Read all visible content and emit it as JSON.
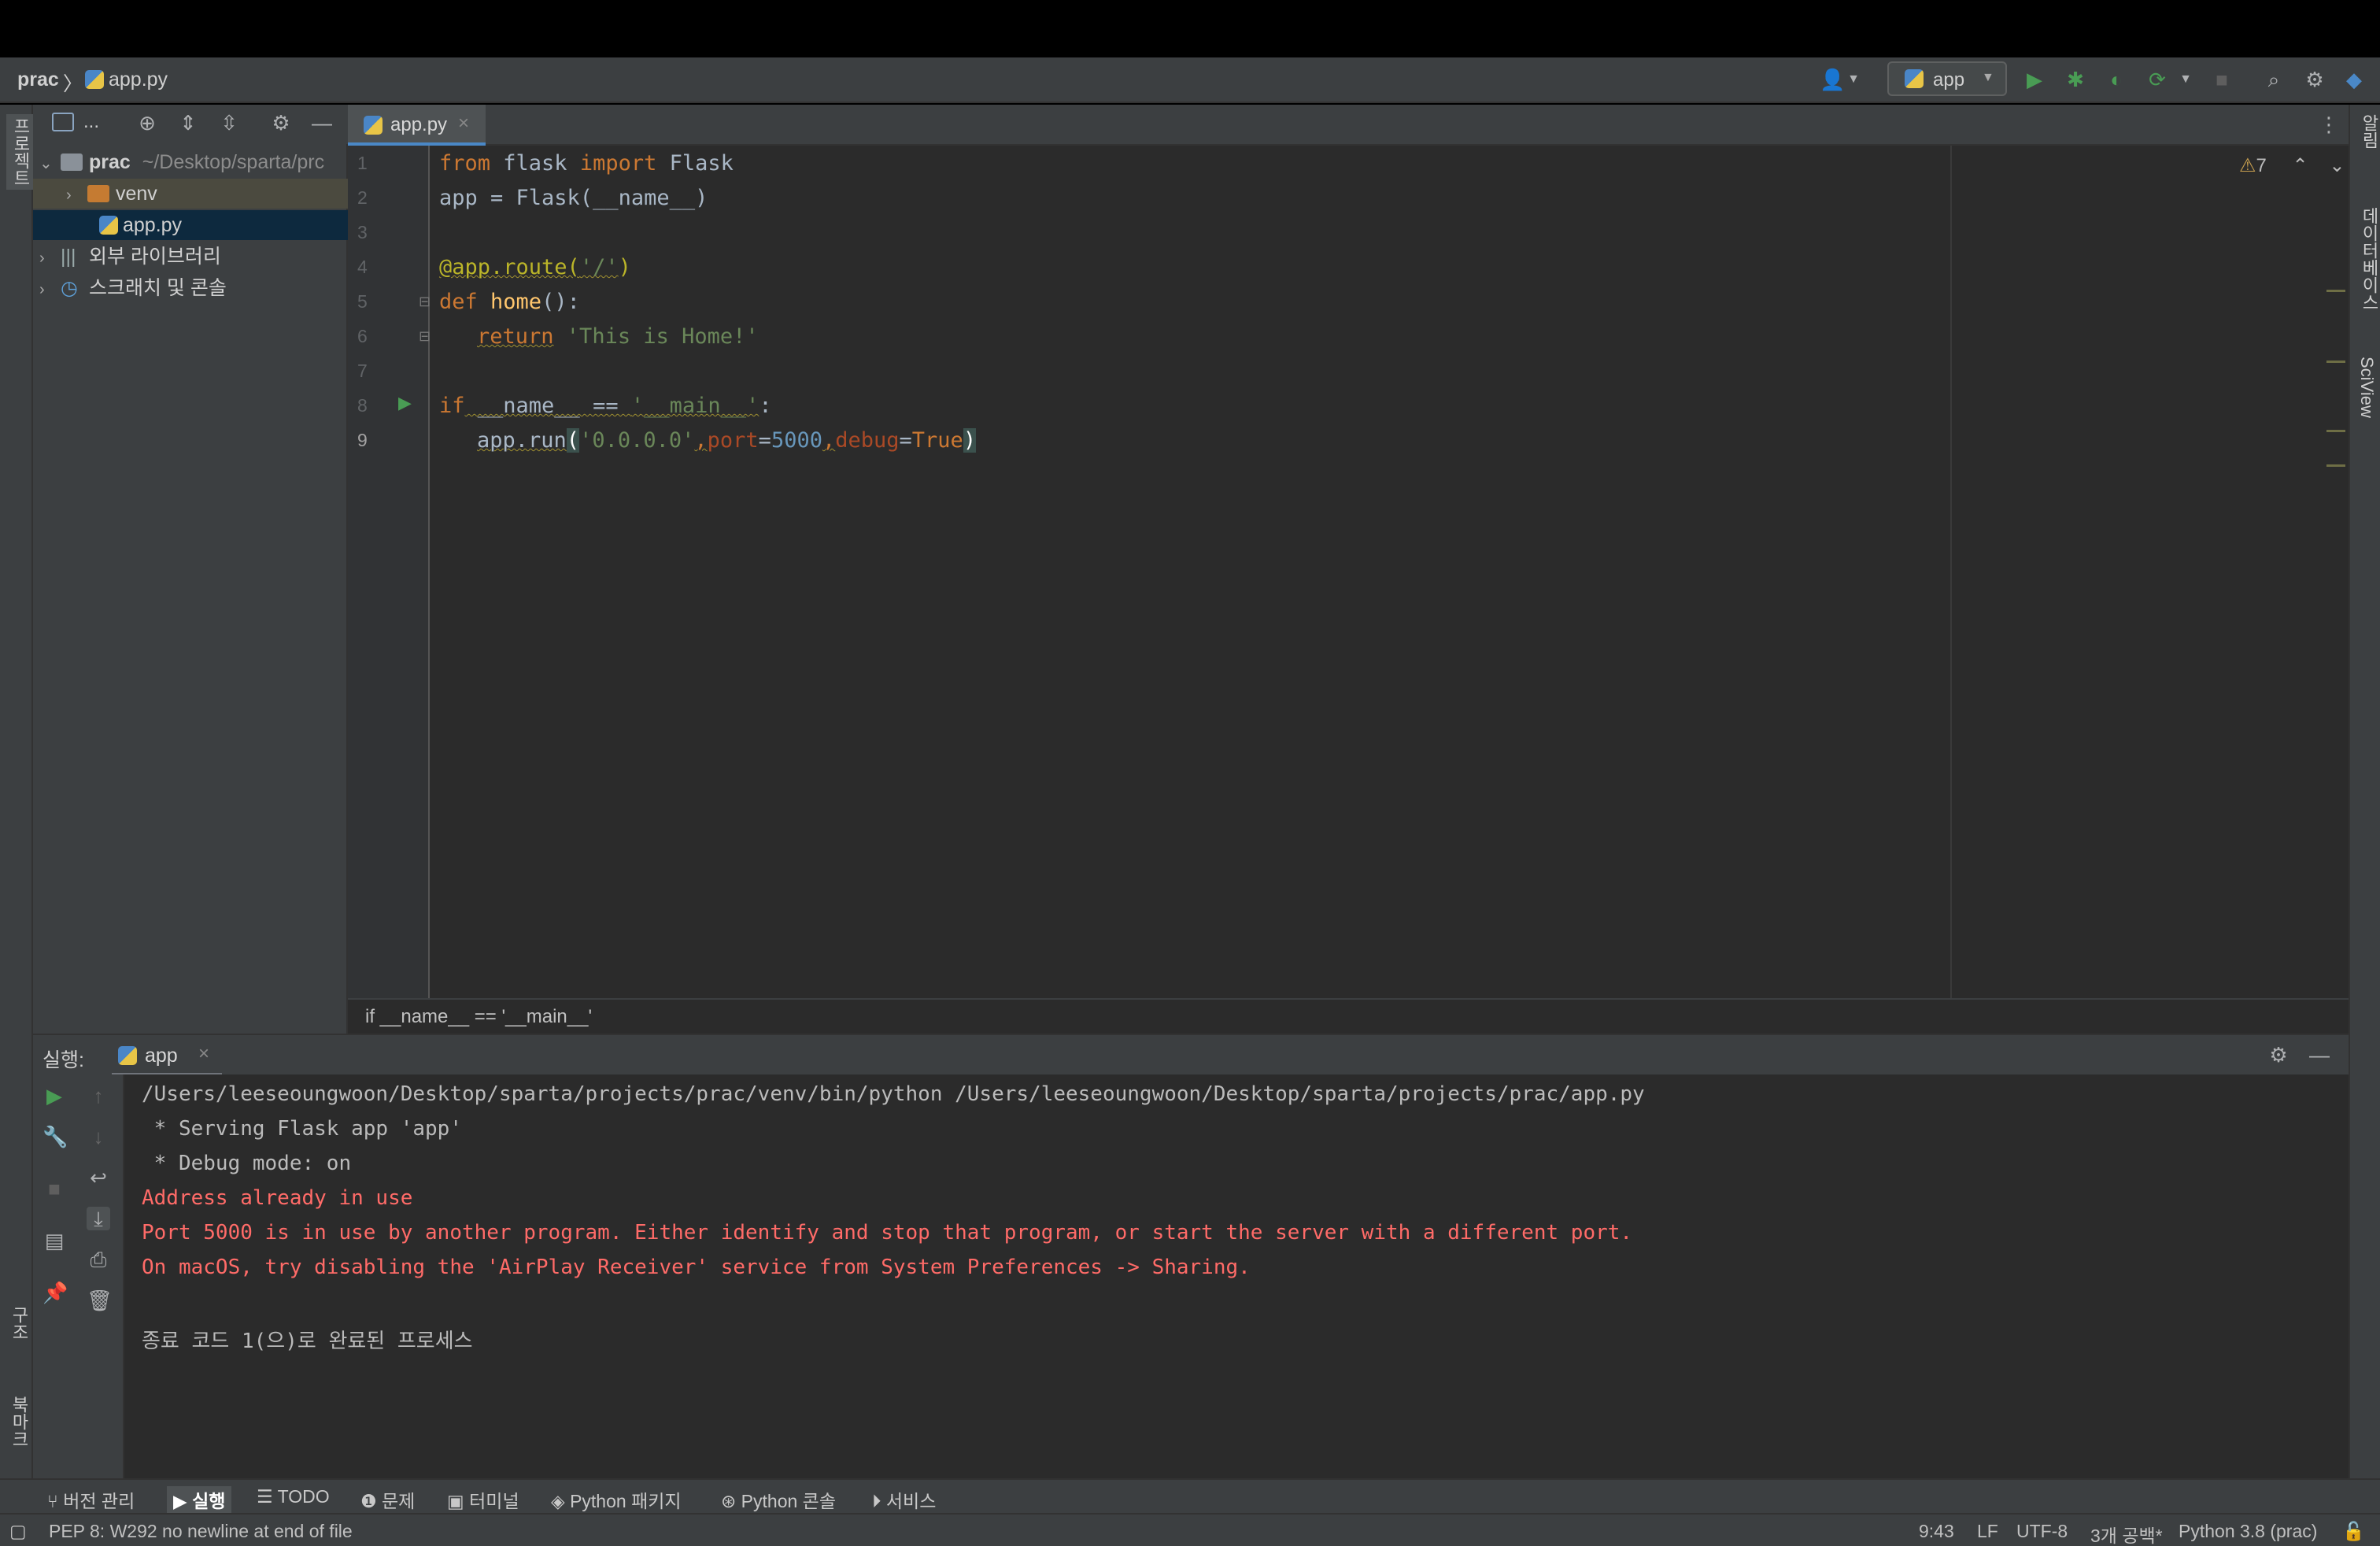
{
  "navbar": {
    "project": "prac",
    "separator": "〉",
    "file": "app.py",
    "run_config": "app"
  },
  "sidebar_left": {
    "project_label": "프로젝트",
    "structure_label": "구조",
    "bookmarks_label": "북마크"
  },
  "sidebar_right": {
    "notifications_label": "알림",
    "database_label": "데이터베이스",
    "sciview_label": "SciView"
  },
  "project_panel": {
    "toolbar_label": "...",
    "tree": [
      {
        "label": "prac",
        "path": "~/Desktop/sparta/prc",
        "type": "root"
      },
      {
        "label": "venv",
        "type": "folder"
      },
      {
        "label": "app.py",
        "type": "file",
        "selected": true
      },
      {
        "label": "외부 라이브러리",
        "type": "libraries"
      },
      {
        "label": "스크래치 및 콘솔",
        "type": "scratches"
      }
    ]
  },
  "editor": {
    "tab_label": "app.py",
    "warning_count": "7",
    "line_numbers": [
      "1",
      "2",
      "3",
      "4",
      "5",
      "6",
      "7",
      "8",
      "9"
    ],
    "breadcrumb": "if __name__ == '__main__'",
    "code": {
      "l1_from": "from",
      "l1_mod": " flask ",
      "l1_import": "import",
      "l1_name": " Flask",
      "l2": "app = Flask(__name__)",
      "l4_deco": "@app.route(",
      "l4_str": "'/'",
      "l4_close": ")",
      "l5_def": "def",
      "l5_fn": " home",
      "l5_rest": "():",
      "l6_ret": "return",
      "l6_str": " 'This is Home!'",
      "l8_if": "if",
      "l8_name": " __name__ == ",
      "l8_str": "'__main__'",
      "l8_colon": ":",
      "l9_call": "app.run",
      "l9_open": "(",
      "l9_host": "'0.0.0.0'",
      "l9_comma1": ",",
      "l9_port_k": "port",
      "l9_eq1": "=",
      "l9_port_v": "5000",
      "l9_comma2": ",",
      "l9_debug_k": "debug",
      "l9_eq2": "=",
      "l9_true": "True",
      "l9_close": ")"
    }
  },
  "run_panel": {
    "title": "실행:",
    "tab_label": "app",
    "output": [
      {
        "text": "/Users/leeseoungwoon/Desktop/sparta/projects/prac/venv/bin/python /Users/leeseoungwoon/Desktop/sparta/projects/prac/app.py",
        "kind": "normal"
      },
      {
        "text": " * Serving Flask app 'app'",
        "kind": "normal"
      },
      {
        "text": " * Debug mode: on",
        "kind": "normal"
      },
      {
        "text": "Address already in use",
        "kind": "error"
      },
      {
        "text": "Port 5000 is in use by another program. Either identify and stop that program, or start the server with a different port.",
        "kind": "error"
      },
      {
        "text": "On macOS, try disabling the 'AirPlay Receiver' service from System Preferences -> Sharing.",
        "kind": "error"
      },
      {
        "text": "",
        "kind": "normal"
      },
      {
        "text": "종료 코드 1(으)로 완료된 프로세스",
        "kind": "normal"
      }
    ]
  },
  "tool_tabs": [
    {
      "label": "버전 관리",
      "icon": "branch-icon"
    },
    {
      "label": "실행",
      "icon": "play-icon",
      "active": true
    },
    {
      "label": "TODO",
      "icon": "list-icon"
    },
    {
      "label": "문제",
      "icon": "info-icon"
    },
    {
      "label": "터미널",
      "icon": "terminal-icon"
    },
    {
      "label": "Python 패키지",
      "icon": "layers-icon"
    },
    {
      "label": "Python 콘솔",
      "icon": "python-icon"
    },
    {
      "label": "서비스",
      "icon": "services-icon"
    }
  ],
  "status_bar": {
    "message": "PEP 8: W292 no newline at end of file",
    "position": "9:43",
    "line_sep": "LF",
    "encoding": "UTF-8",
    "indent": "3개 공백*",
    "interpreter": "Python 3.8 (prac)"
  },
  "colors": {
    "accent": "#4a88c7",
    "error": "#ff6b68",
    "run_green": "#499c54",
    "keyword": "#cc7832",
    "string": "#6a8759",
    "number": "#6897bb"
  }
}
